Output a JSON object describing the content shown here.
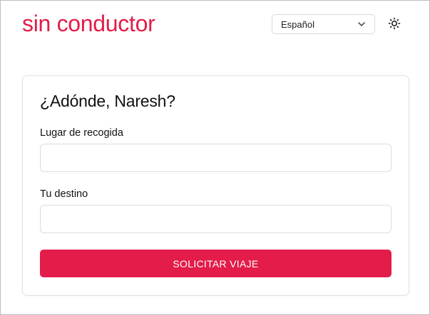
{
  "app": {
    "brand": "sin conductor",
    "accent_color": "#e31c4a"
  },
  "header": {
    "language": {
      "selected": "Español",
      "icon": "chevron-down-icon"
    },
    "theme_toggle": {
      "icon": "sun-icon"
    }
  },
  "ride_form": {
    "title": "¿Adónde, Naresh?",
    "pickup": {
      "label": "Lugar de recogida",
      "value": "",
      "placeholder": ""
    },
    "destination": {
      "label": "Tu destino",
      "value": "",
      "placeholder": ""
    },
    "submit_label": "SOLICITAR VIAJE"
  }
}
